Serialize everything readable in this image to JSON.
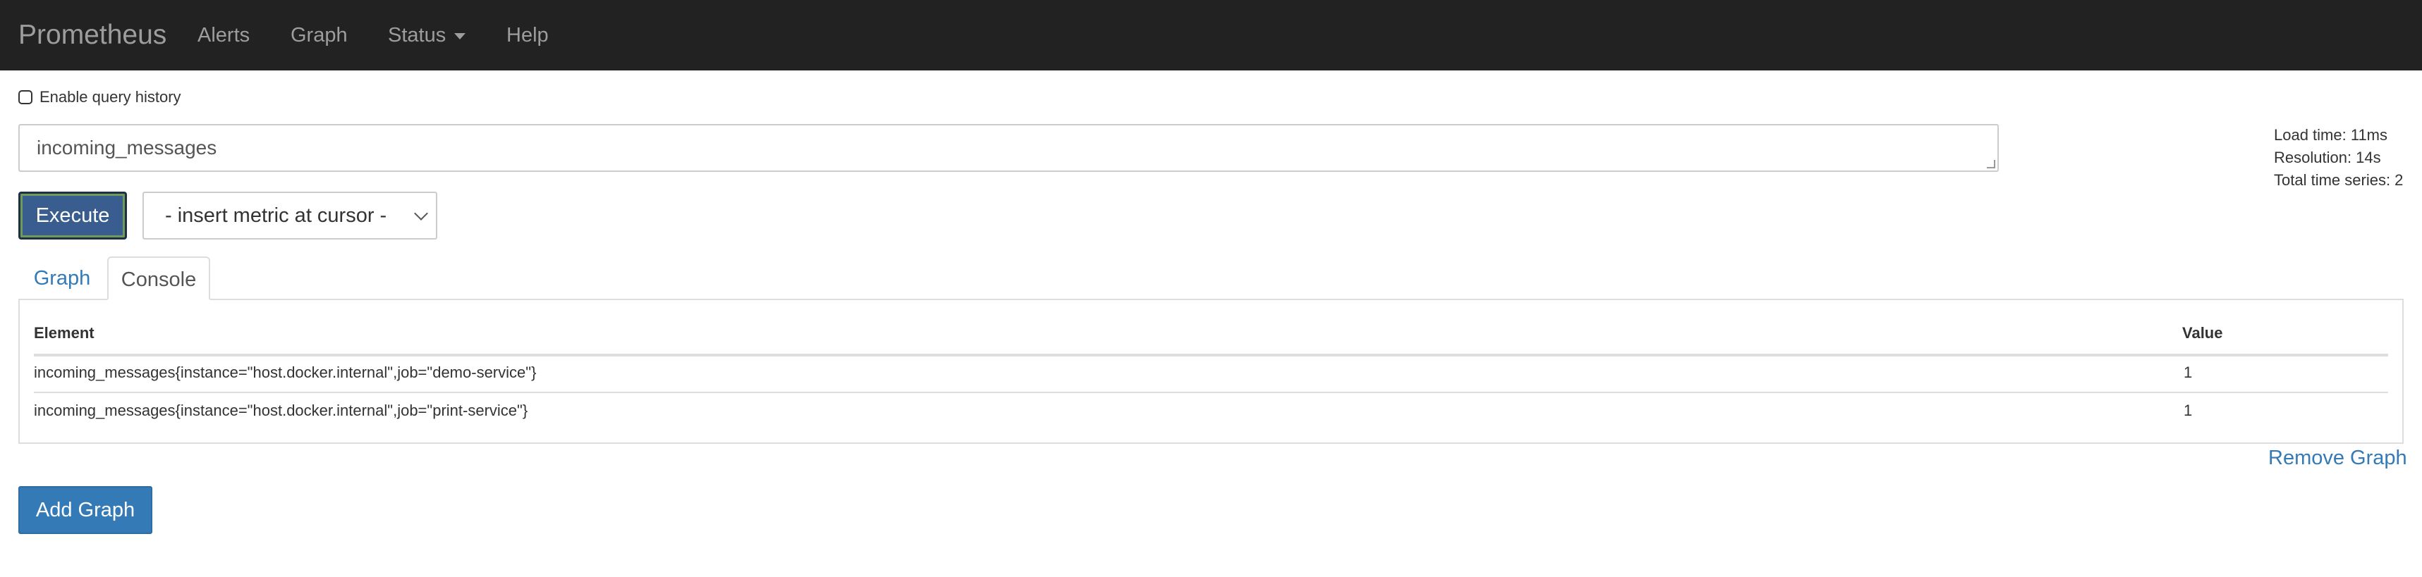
{
  "navbar": {
    "brand": "Prometheus",
    "links": [
      "Alerts",
      "Graph",
      "Status",
      "Help"
    ]
  },
  "query_history": {
    "label": "Enable query history",
    "checked": false
  },
  "expression": {
    "value": "incoming_messages"
  },
  "stats": {
    "load_time": "Load time: 11ms",
    "resolution": "Resolution: 14s",
    "total_series": "Total time series: 2"
  },
  "execute_label": "Execute",
  "metric_select": {
    "selected": "- insert metric at cursor -"
  },
  "tabs": [
    "Graph",
    "Console"
  ],
  "active_tab": "Console",
  "table": {
    "headers": [
      "Element",
      "Value"
    ],
    "rows": [
      {
        "element": "incoming_messages{instance=\"host.docker.internal\",job=\"demo-service\"}",
        "value": "1"
      },
      {
        "element": "incoming_messages{instance=\"host.docker.internal\",job=\"print-service\"}",
        "value": "1"
      }
    ]
  },
  "remove_graph_label": "Remove Graph",
  "add_graph_label": "Add Graph",
  "colors": {
    "navbar_bg": "#222222",
    "link": "#337ab7",
    "execute_bg": "#3a5d8f"
  }
}
